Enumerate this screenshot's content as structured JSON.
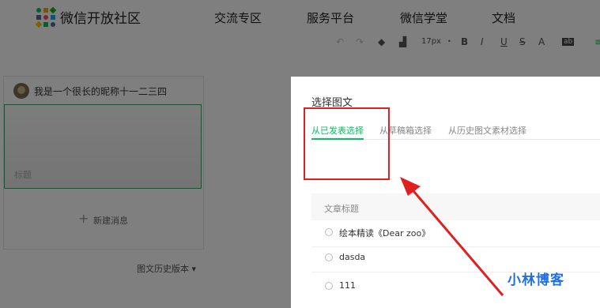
{
  "site": {
    "brand": "微信开放社区",
    "nav": [
      "交流专区",
      "服务平台",
      "微信学堂",
      "文档"
    ]
  },
  "toolbar": {
    "font_size": "17px",
    "bold": "B",
    "italic": "I",
    "underline": "U",
    "strike": "S",
    "font_color": "A",
    "bg_color": "ab"
  },
  "editor": {
    "nickname": "我是一个很长的昵称十一二三四",
    "cover_title": "标题",
    "new_message_label": "新建消息",
    "history_label": "图文历史版本 ▾"
  },
  "dialog": {
    "title": "选择图文",
    "tabs": [
      "从已发表选择",
      "从草稿箱选择",
      "从历史图文素材选择"
    ],
    "column_header": "文章标题",
    "rows": [
      "绘本精读《Dear zoo》",
      "dasda",
      "111"
    ]
  },
  "watermark": "小林博客",
  "colors": {
    "accent": "#07c160",
    "annotation": "#e02020",
    "watermark": "#1f6fe0"
  }
}
